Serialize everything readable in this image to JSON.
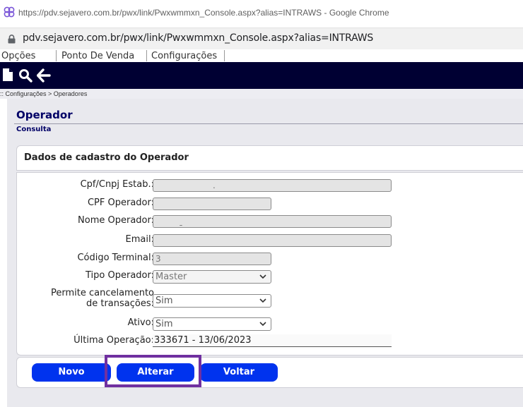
{
  "browser": {
    "window_title": "https://pdv.sejavero.com.br/pwx/link/Pwxwmmxn_Console.aspx?alias=INTRAWS - Google Chrome",
    "address": "pdv.sejavero.com.br/pwx/link/Pwxwmmxn_Console.aspx?alias=INTRAWS"
  },
  "menu": {
    "items": [
      "Opções",
      "Ponto De Venda",
      "Configurações"
    ]
  },
  "toolbar": {
    "icons": [
      "new-document-icon",
      "search-icon",
      "back-arrow-icon"
    ]
  },
  "breadcrumb": ":: Configurações > Operadores",
  "page": {
    "title": "Operador",
    "subtitle": "Consulta"
  },
  "form": {
    "section_title": "Dados de cadastro do Operador",
    "fields": {
      "cpf_cnpj_estab": {
        "label": "Cpf/Cnpj Estab.:",
        "value": "."
      },
      "cpf_operador": {
        "label": "CPF Operador:",
        "value": ""
      },
      "nome_operador": {
        "label": "Nome Operador:",
        "value": "ˍ"
      },
      "email": {
        "label": "Email:",
        "value": ""
      },
      "codigo_terminal": {
        "label": "Código Terminal:",
        "value": "3"
      },
      "tipo_operador": {
        "label": "Tipo Operador:",
        "value": "Master"
      },
      "permite_cancelamento": {
        "label_line1": "Permite cancelamento",
        "label_line2": "de transações:",
        "value": "Sim"
      },
      "ativo": {
        "label": "Ativo:",
        "value": "Sim"
      },
      "ultima_operacao": {
        "label": "Última Operação:",
        "value": "333671 - 13/06/2023"
      }
    }
  },
  "buttons": {
    "novo": "Novo",
    "alterar": "Alterar",
    "voltar": "Voltar"
  },
  "colors": {
    "toolbar_bg": "#000033",
    "button_bg": "#0033ee",
    "highlight_border": "#7030a0",
    "title_color": "#000066"
  }
}
